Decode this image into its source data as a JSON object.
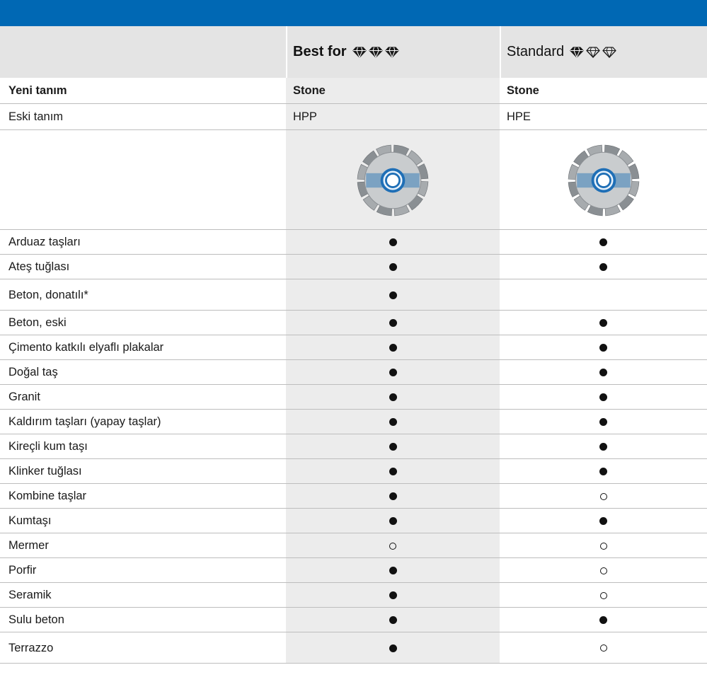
{
  "header": {
    "col1_label": "Best for",
    "col2_label": "Standard",
    "col1_diamonds": [
      "filled",
      "filled",
      "filled"
    ],
    "col2_diamonds": [
      "filled",
      "outline",
      "outline"
    ]
  },
  "info_rows": [
    {
      "label": "Yeni tanım",
      "col1": "Stone",
      "col2": "Stone",
      "bold": true
    },
    {
      "label": "Eski tanım",
      "col1": "HPP",
      "col2": "HPE",
      "bold": false
    }
  ],
  "image_row": {
    "col1_icon": "diamond-cutting-blade-icon",
    "col2_icon": "diamond-cutting-blade-icon"
  },
  "materials": [
    {
      "name": "Arduaz taşları",
      "col1": "full",
      "col2": "full"
    },
    {
      "name": "Ateş tuğlası",
      "col1": "full",
      "col2": "full"
    },
    {
      "name": "Beton, donatılı*",
      "col1": "full",
      "col2": "none"
    },
    {
      "name": "Beton, eski",
      "col1": "full",
      "col2": "full"
    },
    {
      "name": "Çimento katkılı elyaflı plakalar",
      "col1": "full",
      "col2": "full"
    },
    {
      "name": "Doğal taş",
      "col1": "full",
      "col2": "full"
    },
    {
      "name": "Granit",
      "col1": "full",
      "col2": "full"
    },
    {
      "name": "Kaldırım taşları (yapay taşlar)",
      "col1": "full",
      "col2": "full"
    },
    {
      "name": "Kireçli kum taşı",
      "col1": "full",
      "col2": "full"
    },
    {
      "name": "Klinker tuğlası",
      "col1": "full",
      "col2": "full"
    },
    {
      "name": "Kombine taşlar",
      "col1": "full",
      "col2": "partial"
    },
    {
      "name": "Kumtaşı",
      "col1": "full",
      "col2": "full"
    },
    {
      "name": "Mermer",
      "col1": "partial",
      "col2": "partial"
    },
    {
      "name": "Porfir",
      "col1": "full",
      "col2": "partial"
    },
    {
      "name": "Seramik",
      "col1": "full",
      "col2": "partial"
    },
    {
      "name": "Sulu beton",
      "col1": "full",
      "col2": "full"
    },
    {
      "name": "Terrazzo",
      "col1": "full",
      "col2": "partial"
    }
  ],
  "colors": {
    "brand_bar": "#0068b4",
    "header_bg": "#e4e4e4",
    "highlight_column": "#ececec"
  }
}
